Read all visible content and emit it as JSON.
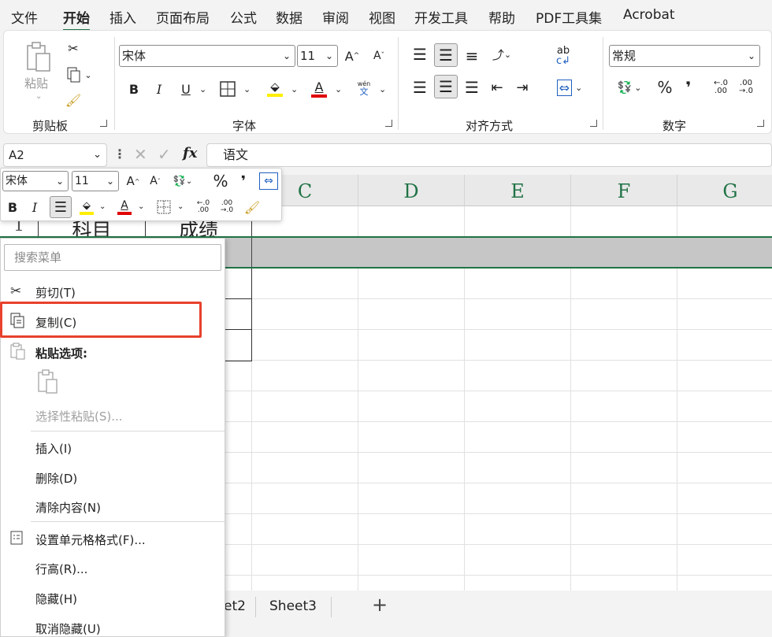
{
  "menu": {
    "tabs": [
      "文件",
      "开始",
      "插入",
      "页面布局",
      "公式",
      "数据",
      "审阅",
      "视图",
      "开发工具",
      "帮助",
      "PDF工具集",
      "Acrobat"
    ],
    "active": "开始"
  },
  "ribbon": {
    "clipboard": {
      "label": "剪贴板",
      "paste": "粘贴"
    },
    "font": {
      "label": "字体",
      "name": "宋体",
      "size": "11",
      "bold": "B",
      "italic": "I",
      "underline": "U",
      "grow": "A^",
      "shrink": "Aˇ",
      "phonetic_top": "wén",
      "phonetic_bottom": "文"
    },
    "alignment": {
      "label": "对齐方式"
    },
    "number": {
      "label": "数字",
      "format": "常规",
      "percent": "%",
      "comma": "❜"
    }
  },
  "formula_bar": {
    "name_box": "A2",
    "fx": "fx",
    "value": "语文"
  },
  "grid": {
    "columns": [
      "C",
      "D",
      "E",
      "F",
      "G"
    ],
    "row1": {
      "num": "1",
      "a": "科目",
      "b": "成绩"
    },
    "accent": "#217346"
  },
  "mini_toolbar": {
    "font": "宋体",
    "size": "11",
    "bold": "B",
    "italic": "I",
    "percent": "%",
    "comma": "❜"
  },
  "context_menu": {
    "search_placeholder": "搜索菜单",
    "items": {
      "cut": "剪切(T)",
      "copy": "复制(C)",
      "paste_options": "粘贴选项:",
      "paste_special": "选择性粘贴(S)...",
      "insert": "插入(I)",
      "delete": "删除(D)",
      "clear": "清除内容(N)",
      "format_cells": "设置单元格格式(F)...",
      "row_height": "行高(R)...",
      "hide": "隐藏(H)",
      "unhide": "取消隐藏(U)"
    },
    "highlight_color": "#e8412c"
  },
  "sheets": {
    "tab2": "et2",
    "tab3": "Sheet3",
    "add": "+"
  }
}
